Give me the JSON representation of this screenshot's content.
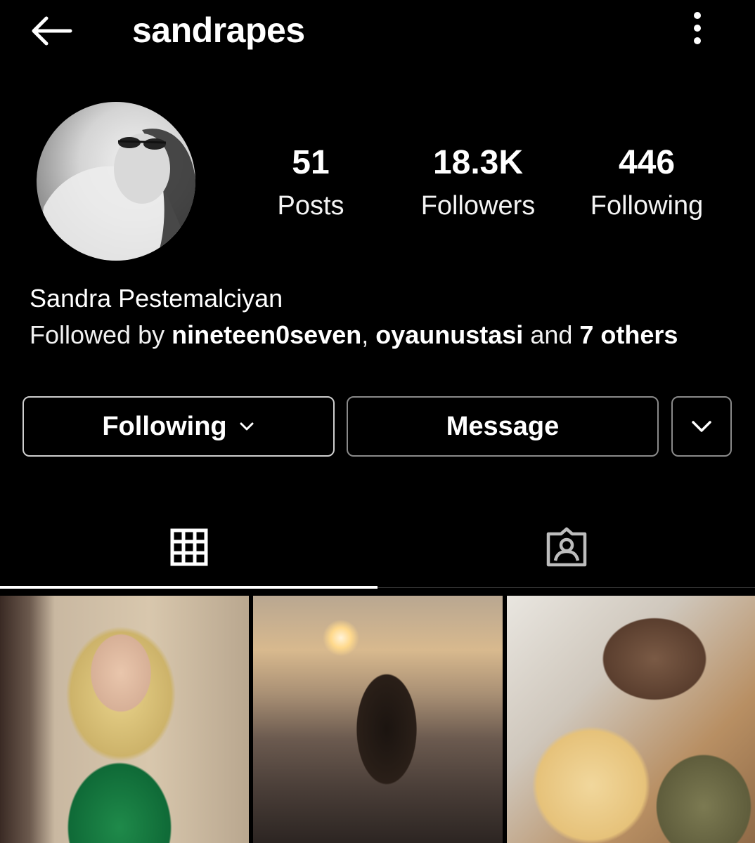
{
  "header": {
    "username": "sandrapes",
    "back_icon": "arrow-left-icon",
    "more_icon": "vertical-dots-icon"
  },
  "profile": {
    "avatar_icon": "profile-photo",
    "stats": {
      "posts": {
        "value": "51",
        "label": "Posts"
      },
      "followers": {
        "value": "18.3K",
        "label": "Followers"
      },
      "following": {
        "value": "446",
        "label": "Following"
      }
    },
    "full_name": "Sandra Pestemalciyan",
    "followed_by": {
      "prefix": "Followed by ",
      "user1": "nineteen0seven",
      "sep": ", ",
      "user2": "oyaunustasi",
      "mid": " and ",
      "others": "7 others"
    }
  },
  "actions": {
    "following_label": "Following",
    "message_label": "Message",
    "suggest_icon": "chevron-down-icon"
  },
  "tabs": [
    {
      "icon": "grid-icon",
      "active": true
    },
    {
      "icon": "tagged-person-icon",
      "active": false
    }
  ],
  "posts_shown": 3,
  "colors": {
    "background": "#000000",
    "text": "#ffffff",
    "button_border": "#cfcfcf"
  }
}
